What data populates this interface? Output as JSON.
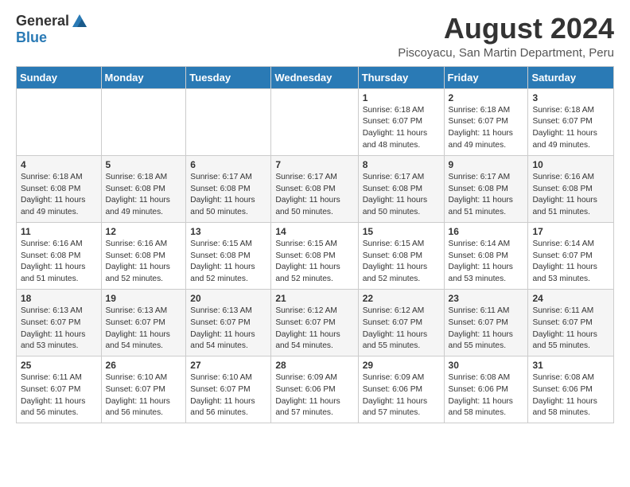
{
  "logo": {
    "general": "General",
    "blue": "Blue"
  },
  "title": "August 2024",
  "subtitle": "Piscoyacu, San Martin Department, Peru",
  "headers": [
    "Sunday",
    "Monday",
    "Tuesday",
    "Wednesday",
    "Thursday",
    "Friday",
    "Saturday"
  ],
  "weeks": [
    [
      {
        "day": "",
        "content": ""
      },
      {
        "day": "",
        "content": ""
      },
      {
        "day": "",
        "content": ""
      },
      {
        "day": "",
        "content": ""
      },
      {
        "day": "1",
        "content": "Sunrise: 6:18 AM\nSunset: 6:07 PM\nDaylight: 11 hours\nand 48 minutes."
      },
      {
        "day": "2",
        "content": "Sunrise: 6:18 AM\nSunset: 6:07 PM\nDaylight: 11 hours\nand 49 minutes."
      },
      {
        "day": "3",
        "content": "Sunrise: 6:18 AM\nSunset: 6:07 PM\nDaylight: 11 hours\nand 49 minutes."
      }
    ],
    [
      {
        "day": "4",
        "content": "Sunrise: 6:18 AM\nSunset: 6:08 PM\nDaylight: 11 hours\nand 49 minutes."
      },
      {
        "day": "5",
        "content": "Sunrise: 6:18 AM\nSunset: 6:08 PM\nDaylight: 11 hours\nand 49 minutes."
      },
      {
        "day": "6",
        "content": "Sunrise: 6:17 AM\nSunset: 6:08 PM\nDaylight: 11 hours\nand 50 minutes."
      },
      {
        "day": "7",
        "content": "Sunrise: 6:17 AM\nSunset: 6:08 PM\nDaylight: 11 hours\nand 50 minutes."
      },
      {
        "day": "8",
        "content": "Sunrise: 6:17 AM\nSunset: 6:08 PM\nDaylight: 11 hours\nand 50 minutes."
      },
      {
        "day": "9",
        "content": "Sunrise: 6:17 AM\nSunset: 6:08 PM\nDaylight: 11 hours\nand 51 minutes."
      },
      {
        "day": "10",
        "content": "Sunrise: 6:16 AM\nSunset: 6:08 PM\nDaylight: 11 hours\nand 51 minutes."
      }
    ],
    [
      {
        "day": "11",
        "content": "Sunrise: 6:16 AM\nSunset: 6:08 PM\nDaylight: 11 hours\nand 51 minutes."
      },
      {
        "day": "12",
        "content": "Sunrise: 6:16 AM\nSunset: 6:08 PM\nDaylight: 11 hours\nand 52 minutes."
      },
      {
        "day": "13",
        "content": "Sunrise: 6:15 AM\nSunset: 6:08 PM\nDaylight: 11 hours\nand 52 minutes."
      },
      {
        "day": "14",
        "content": "Sunrise: 6:15 AM\nSunset: 6:08 PM\nDaylight: 11 hours\nand 52 minutes."
      },
      {
        "day": "15",
        "content": "Sunrise: 6:15 AM\nSunset: 6:08 PM\nDaylight: 11 hours\nand 52 minutes."
      },
      {
        "day": "16",
        "content": "Sunrise: 6:14 AM\nSunset: 6:08 PM\nDaylight: 11 hours\nand 53 minutes."
      },
      {
        "day": "17",
        "content": "Sunrise: 6:14 AM\nSunset: 6:07 PM\nDaylight: 11 hours\nand 53 minutes."
      }
    ],
    [
      {
        "day": "18",
        "content": "Sunrise: 6:13 AM\nSunset: 6:07 PM\nDaylight: 11 hours\nand 53 minutes."
      },
      {
        "day": "19",
        "content": "Sunrise: 6:13 AM\nSunset: 6:07 PM\nDaylight: 11 hours\nand 54 minutes."
      },
      {
        "day": "20",
        "content": "Sunrise: 6:13 AM\nSunset: 6:07 PM\nDaylight: 11 hours\nand 54 minutes."
      },
      {
        "day": "21",
        "content": "Sunrise: 6:12 AM\nSunset: 6:07 PM\nDaylight: 11 hours\nand 54 minutes."
      },
      {
        "day": "22",
        "content": "Sunrise: 6:12 AM\nSunset: 6:07 PM\nDaylight: 11 hours\nand 55 minutes."
      },
      {
        "day": "23",
        "content": "Sunrise: 6:11 AM\nSunset: 6:07 PM\nDaylight: 11 hours\nand 55 minutes."
      },
      {
        "day": "24",
        "content": "Sunrise: 6:11 AM\nSunset: 6:07 PM\nDaylight: 11 hours\nand 55 minutes."
      }
    ],
    [
      {
        "day": "25",
        "content": "Sunrise: 6:11 AM\nSunset: 6:07 PM\nDaylight: 11 hours\nand 56 minutes."
      },
      {
        "day": "26",
        "content": "Sunrise: 6:10 AM\nSunset: 6:07 PM\nDaylight: 11 hours\nand 56 minutes."
      },
      {
        "day": "27",
        "content": "Sunrise: 6:10 AM\nSunset: 6:07 PM\nDaylight: 11 hours\nand 56 minutes."
      },
      {
        "day": "28",
        "content": "Sunrise: 6:09 AM\nSunset: 6:06 PM\nDaylight: 11 hours\nand 57 minutes."
      },
      {
        "day": "29",
        "content": "Sunrise: 6:09 AM\nSunset: 6:06 PM\nDaylight: 11 hours\nand 57 minutes."
      },
      {
        "day": "30",
        "content": "Sunrise: 6:08 AM\nSunset: 6:06 PM\nDaylight: 11 hours\nand 58 minutes."
      },
      {
        "day": "31",
        "content": "Sunrise: 6:08 AM\nSunset: 6:06 PM\nDaylight: 11 hours\nand 58 minutes."
      }
    ]
  ]
}
